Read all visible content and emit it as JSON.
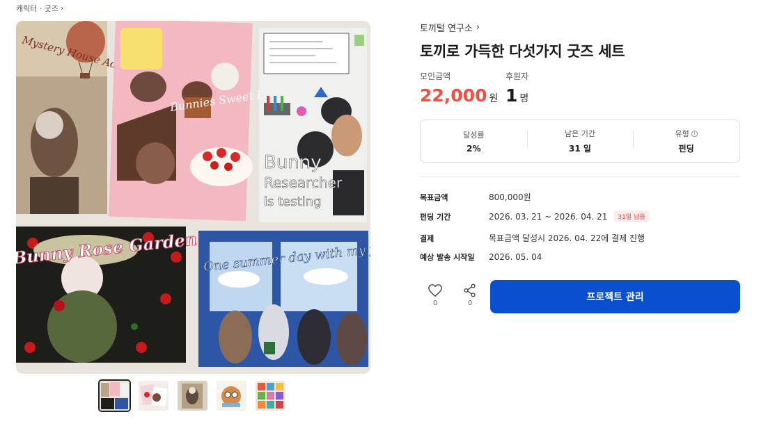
{
  "breadcrumb": {
    "label": "캐릭터 · 굿즈"
  },
  "project": {
    "creator": "토끼털 연구소",
    "title": "토끼로 가득한 다섯가지 굿즈 세트"
  },
  "stats": {
    "funding_label": "모인금액",
    "funding_amount": "22,000",
    "funding_unit": "원",
    "backers_label": "후원자",
    "backers_count": "1",
    "backers_unit": "명"
  },
  "summary": {
    "achievement_label": "달성률",
    "achievement_value": "2%",
    "remaining_label": "남은 기간",
    "remaining_value": "31 일",
    "type_label": "유형",
    "type_value": "펀딩"
  },
  "details": {
    "goal_key": "목표금액",
    "goal_value": "800,000원",
    "period_key": "펀딩 기간",
    "period_value": "2026. 03. 21 ~ 2026. 04. 21",
    "period_badge": "31일 남음",
    "payment_key": "결제",
    "payment_value": "목표금액 달성시 2026. 04. 22에 결제 진행",
    "ship_key": "예상 발송 시작일",
    "ship_value": "2026. 05. 04"
  },
  "actions": {
    "like_count": "0",
    "share_count": "0",
    "manage_label": "프로젝트 관리"
  },
  "image_text": {
    "card1": "Mystery House Adventure!",
    "card2": "Bunnies Sweet Party",
    "card3_line1": "Bunny",
    "card3_line2": "Researcher",
    "card3_line3": "is testing",
    "card4": "Bunny Rose Garden",
    "card5": "One summer day with my friends"
  },
  "colors": {
    "accent_red": "#f14f3f",
    "primary_blue": "#0a4fcf"
  }
}
